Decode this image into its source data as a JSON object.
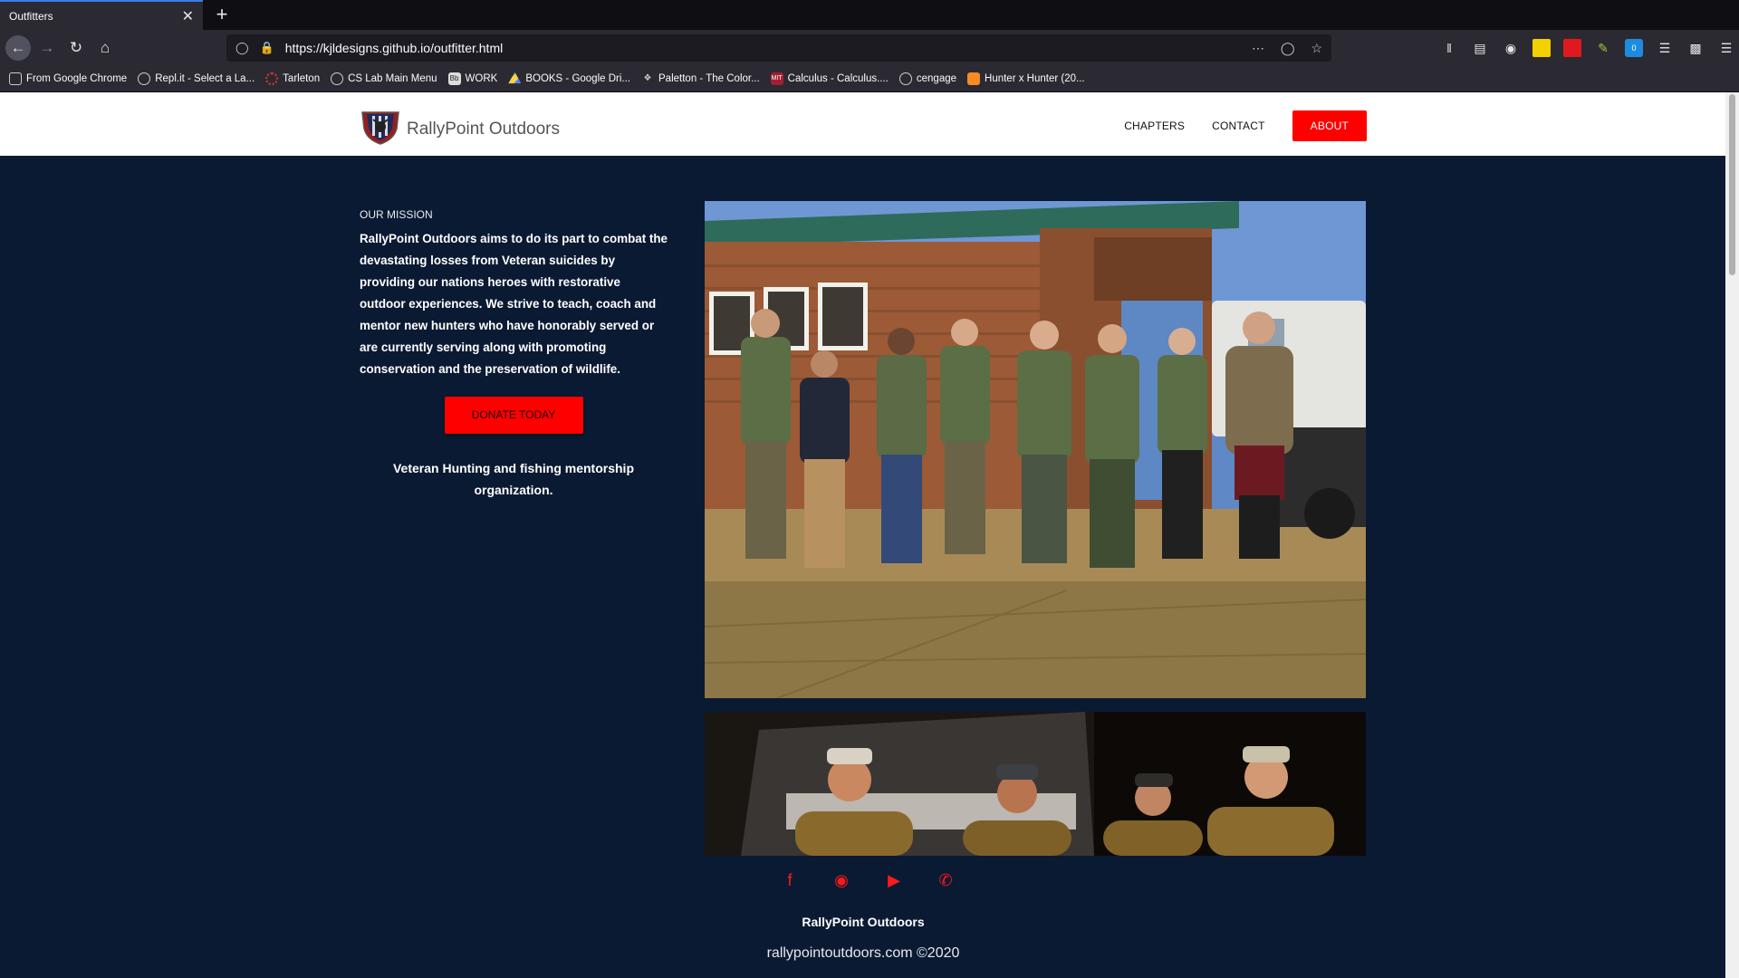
{
  "browser": {
    "tab_title": "Outfitters",
    "tab_close": "✕",
    "new_tab": "+",
    "url": "https://kjldesigns.github.io/outfitter.html",
    "bookmarks": [
      {
        "label": "From Google Chrome",
        "icon": "folder-icon"
      },
      {
        "label": "Repl.it - Select a La...",
        "icon": "replit-icon"
      },
      {
        "label": "Tarleton",
        "icon": "tarleton-icon"
      },
      {
        "label": "CS Lab Main Menu",
        "icon": "globe-icon"
      },
      {
        "label": "WORK",
        "icon": "bb-icon"
      },
      {
        "label": "BOOKS - Google Dri...",
        "icon": "drive-icon"
      },
      {
        "label": "Paletton - The Color...",
        "icon": "paletton-icon"
      },
      {
        "label": "Calculus - Calculus....",
        "icon": "mit-icon"
      },
      {
        "label": "cengage",
        "icon": "globe-icon"
      },
      {
        "label": "Hunter x Hunter (20...",
        "icon": "crunchyroll-icon"
      }
    ],
    "extension_badge": "0"
  },
  "site": {
    "brand_name": "RallyPoint Outdoors",
    "nav": {
      "chapters": "CHAPTERS",
      "contact": "CONTACT",
      "about": "ABOUT"
    },
    "mission": {
      "heading": "OUR MISSION",
      "text": "RallyPoint Outdoors aims to do its part to combat the devastating losses from Veteran suicides by providing our nations heroes with restorative outdoor experiences. We strive to teach, coach and mentor new hunters who have honorably served or are currently serving along with promoting conservation and the preservation of wildlife.",
      "donate_label": "DONATE TODAY",
      "tagline": "Veteran Hunting and fishing mentorship organization."
    },
    "footer": {
      "name": "RallyPoint Outdoors",
      "copyright": "rallypointoutdoors.com ©2020"
    },
    "socials": [
      "facebook-icon",
      "instagram-icon",
      "youtube-icon",
      "phone-icon"
    ]
  },
  "colors": {
    "page_bg": "#0b1a33",
    "accent_red": "#ff0000",
    "header_bg": "#ffffff"
  }
}
